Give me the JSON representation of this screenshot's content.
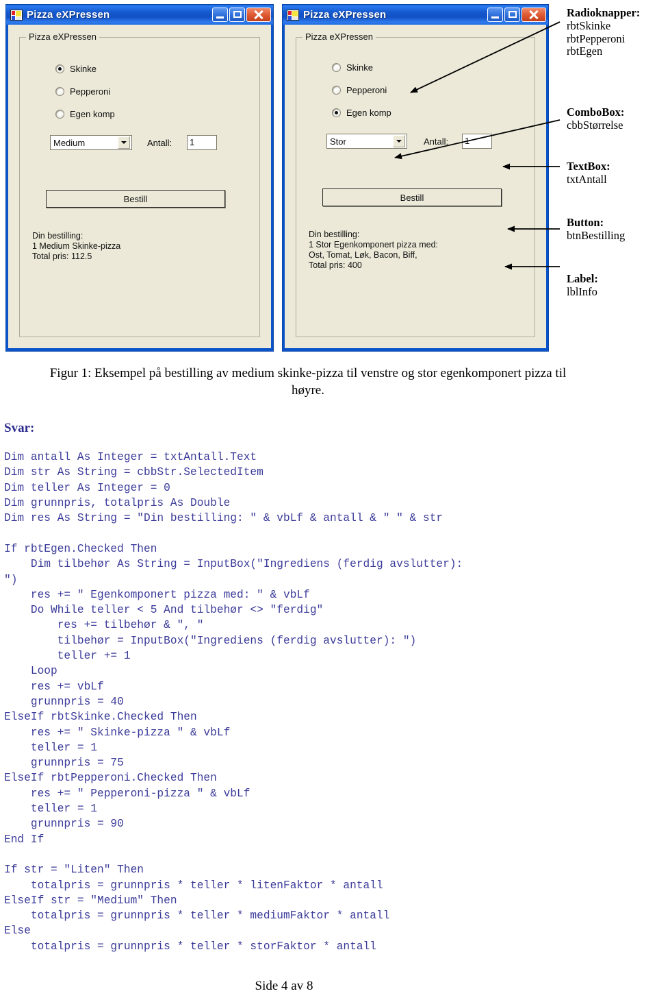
{
  "figure": {
    "windows": [
      {
        "id": "left",
        "title": "Pizza eXPressen",
        "groupbox_title": "Pizza eXPressen",
        "radios": [
          {
            "label": "Skinke",
            "checked": true
          },
          {
            "label": "Pepperoni",
            "checked": false
          },
          {
            "label": "Egen komp",
            "checked": false
          }
        ],
        "combo_value": "Medium",
        "antall_label": "Antall:",
        "antall_value": "1",
        "button_label": "Bestill",
        "info_text": "Din bestilling:\n1 Medium Skinke-pizza\nTotal pris: 112.5"
      },
      {
        "id": "right",
        "title": "Pizza eXPressen",
        "groupbox_title": "Pizza eXPressen",
        "radios": [
          {
            "label": "Skinke",
            "checked": false
          },
          {
            "label": "Pepperoni",
            "checked": false
          },
          {
            "label": "Egen komp",
            "checked": true
          }
        ],
        "combo_value": "Stor",
        "antall_label": "Antall:",
        "antall_value": "1",
        "button_label": "Bestill",
        "info_text": "Din bestilling:\n1 Stor Egenkomponert pizza med:\nOst, Tomat, Løk, Bacon, Biff,\nTotal pris: 400"
      }
    ],
    "callouts": [
      {
        "heading": "Radioknapper:",
        "items": [
          "rbtSkinke",
          "rbtPepperoni",
          "rbtEgen"
        ]
      },
      {
        "heading": "ComboBox:",
        "items": [
          "cbbStørrelse"
        ]
      },
      {
        "heading": "TextBox:",
        "items": [
          "txtAntall"
        ]
      },
      {
        "heading": "Button:",
        "items": [
          "btnBestilling"
        ]
      },
      {
        "heading": "Label:",
        "items": [
          "lblInfo"
        ]
      }
    ]
  },
  "caption": "Figur 1: Eksempel på bestilling av medium skinke-pizza til venstre og stor egenkomponert pizza til høyre.",
  "answer_heading": "Svar:",
  "code": "Dim antall As Integer = txtAntall.Text\nDim str As String = cbbStr.SelectedItem\nDim teller As Integer = 0\nDim grunnpris, totalpris As Double\nDim res As String = \"Din bestilling: \" & vbLf & antall & \" \" & str\n\nIf rbtEgen.Checked Then\n    Dim tilbehør As String = InputBox(\"Ingrediens (ferdig avslutter):\n\")\n    res += \" Egenkomponert pizza med: \" & vbLf\n    Do While teller < 5 And tilbehør <> \"ferdig\"\n        res += tilbehør & \", \"\n        tilbehør = InputBox(\"Ingrediens (ferdig avslutter): \")\n        teller += 1\n    Loop\n    res += vbLf\n    grunnpris = 40\nElseIf rbtSkinke.Checked Then\n    res += \" Skinke-pizza \" & vbLf\n    teller = 1\n    grunnpris = 75\nElseIf rbtPepperoni.Checked Then\n    res += \" Pepperoni-pizza \" & vbLf\n    teller = 1\n    grunnpris = 90\nEnd If\n\nIf str = \"Liten\" Then\n    totalpris = grunnpris * teller * litenFaktor * antall\nElseIf str = \"Medium\" Then\n    totalpris = grunnpris * teller * mediumFaktor * antall\nElse\n    totalpris = grunnpris * teller * storFaktor * antall",
  "footer": "Side 4 av 8",
  "colors": {
    "titlebar_blue": "#1557cc",
    "form_face": "#ece9d8",
    "code_blue": "#3b3b9a",
    "heading_blue": "#2b2b8f"
  }
}
